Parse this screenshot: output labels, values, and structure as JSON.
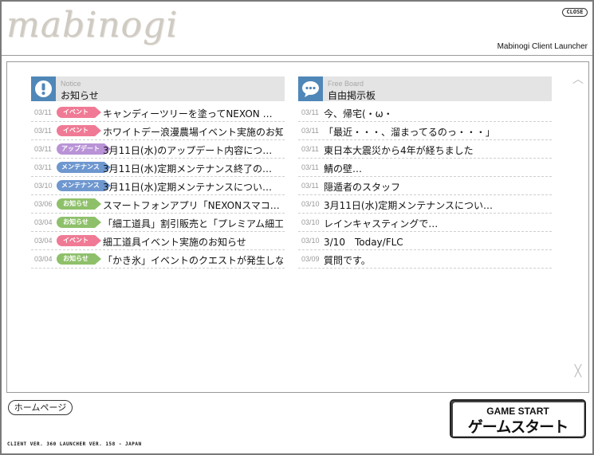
{
  "header": {
    "logo_text": "mabinogi",
    "close_label": "CLOSE",
    "app_title": "Mabinogi Client Launcher"
  },
  "colors": {
    "panel_icon": "#4f87b8",
    "badge_event": "#f07a95",
    "badge_update": "#b993d6",
    "badge_maintenance": "#6e97cf",
    "badge_notice": "#8ec06a"
  },
  "notice": {
    "subtitle": "Notice",
    "title": "お知らせ",
    "icon": "exclamation-icon",
    "items": [
      {
        "date": "03/11",
        "badge": "イベント",
        "badge_type": "event",
        "title": "キャンディーツリーを塗ってNEXON …"
      },
      {
        "date": "03/11",
        "badge": "イベント",
        "badge_type": "event",
        "title": "ホワイトデー浪漫農場イベント実施のお知…"
      },
      {
        "date": "03/11",
        "badge": "アップデート",
        "badge_type": "update",
        "title": "3月11日(水)のアップデート内容につ…"
      },
      {
        "date": "03/11",
        "badge": "メンテナンス",
        "badge_type": "maintenance",
        "title": "3月11日(水)定期メンテナンス終了の…"
      },
      {
        "date": "03/10",
        "badge": "メンテナンス",
        "badge_type": "maintenance",
        "title": "3月11日(水)定期メンテナンスについ…"
      },
      {
        "date": "03/06",
        "badge": "お知らせ",
        "badge_type": "notice",
        "title": "スマートフォンアプリ「NEXONスマコ…"
      },
      {
        "date": "03/04",
        "badge": "お知らせ",
        "badge_type": "notice",
        "title": "「細工道具」割引販売と「プレミアム細工…"
      },
      {
        "date": "03/04",
        "badge": "イベント",
        "badge_type": "event",
        "title": "細工道具イベント実施のお知らせ"
      },
      {
        "date": "03/04",
        "badge": "お知らせ",
        "badge_type": "notice",
        "title": "「かき氷」イベントのクエストが発生しな…"
      }
    ]
  },
  "board": {
    "subtitle": "Free Board",
    "title": "自由掲示板",
    "icon": "speech-bubble-icon",
    "items": [
      {
        "date": "03/11",
        "title": "今、帰宅(・ω・"
      },
      {
        "date": "03/11",
        "title": "「最近・・・、溜まってるのっ・・・」"
      },
      {
        "date": "03/11",
        "title": "東日本大震災から4年が経ちました"
      },
      {
        "date": "03/11",
        "title": "鯖の壁…"
      },
      {
        "date": "03/11",
        "title": "隠遁者のスタッフ"
      },
      {
        "date": "03/10",
        "title": "3月11日(水)定期メンテナンスについ…"
      },
      {
        "date": "03/10",
        "title": "レインキャスティングで…"
      },
      {
        "date": "03/10",
        "title": "3/10　Today/FLC"
      },
      {
        "date": "03/09",
        "title": "質問です。"
      }
    ]
  },
  "footer": {
    "home_label": "ホームページ",
    "start_en": "GAME START",
    "start_jp": "ゲームスタート",
    "version": "CLIENT VER. 360  LAUNCHER VER. 158 - JAPAN"
  }
}
